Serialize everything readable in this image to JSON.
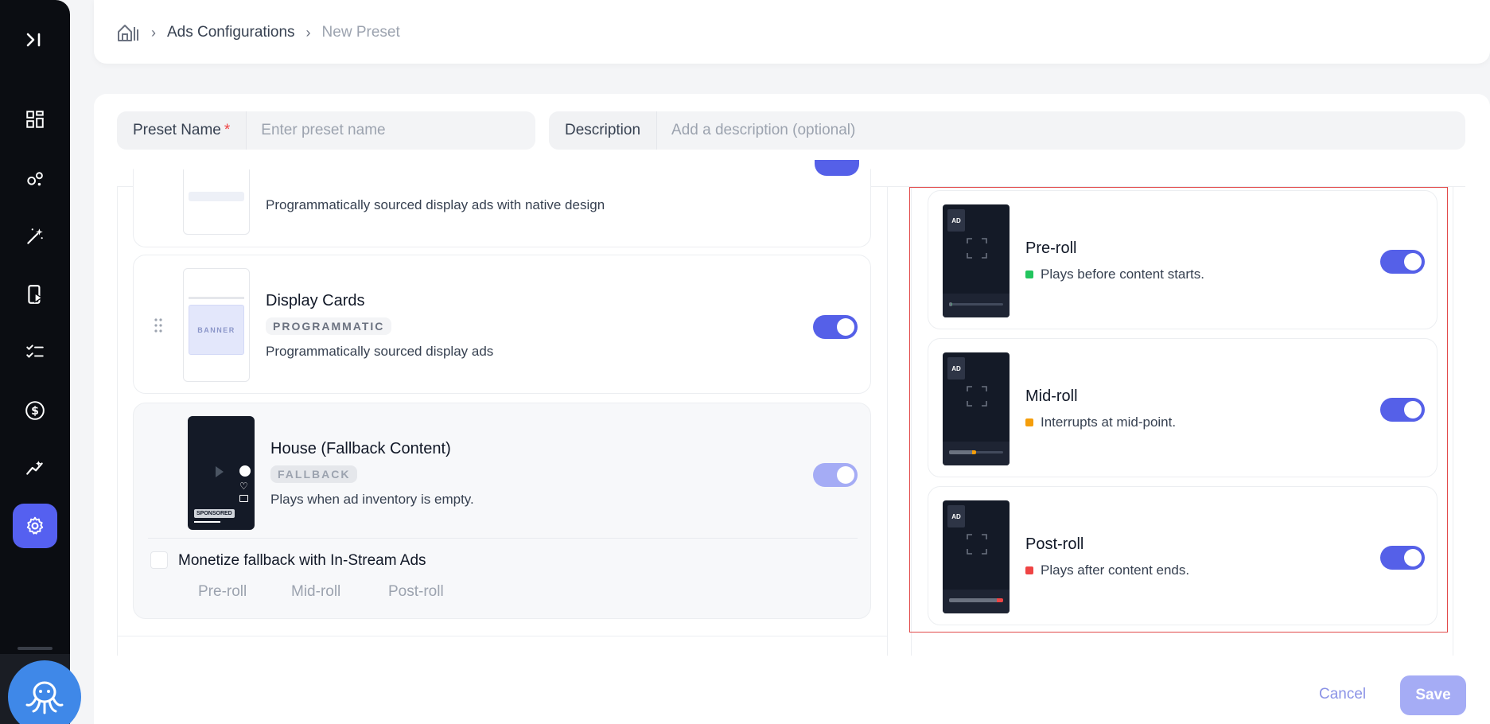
{
  "breadcrumb": {
    "home_icon": "home-icon",
    "items": [
      "Ads Configurations",
      "New Preset"
    ]
  },
  "form": {
    "preset_name_label": "Preset Name",
    "preset_name_required": "*",
    "preset_name_placeholder": "Enter preset name",
    "description_label": "Description",
    "description_placeholder": "Add a description (optional)"
  },
  "ad_types": [
    {
      "title": "",
      "badge": "",
      "description": "Programmatically sourced display ads with native design",
      "enabled": true
    },
    {
      "title": "Display Cards",
      "badge": "PROGRAMMATIC",
      "thumb_label": "BANNER",
      "description": "Programmatically sourced display ads",
      "enabled": true
    },
    {
      "title": "House (Fallback Content)",
      "badge": "FALLBACK",
      "thumb_label": "SPONSORED",
      "description": "Plays when ad inventory is empty.",
      "enabled": true
    }
  ],
  "fallback_monetize": {
    "label": "Monetize fallback with In-Stream Ads",
    "checked": false,
    "options": [
      "Pre-roll",
      "Mid-roll",
      "Post-roll"
    ]
  },
  "instream": [
    {
      "tag": "AD",
      "title": "Pre-roll",
      "description": "Plays before content starts.",
      "color": "#22c55e",
      "progress": 0.04,
      "enabled": true
    },
    {
      "tag": "AD",
      "title": "Mid-roll",
      "description": "Interrupts at mid-point.",
      "color": "#f59e0b",
      "progress": 0.5,
      "enabled": true
    },
    {
      "tag": "AD",
      "title": "Post-roll",
      "description": "Plays after content ends.",
      "color": "#ef4444",
      "progress": 1.0,
      "enabled": true
    }
  ],
  "actions": {
    "cancel": "Cancel",
    "save": "Save"
  },
  "colors": {
    "accent": "#5560e8",
    "sidebar": "#0b0d12",
    "highlight_border": "#e24a4a"
  }
}
